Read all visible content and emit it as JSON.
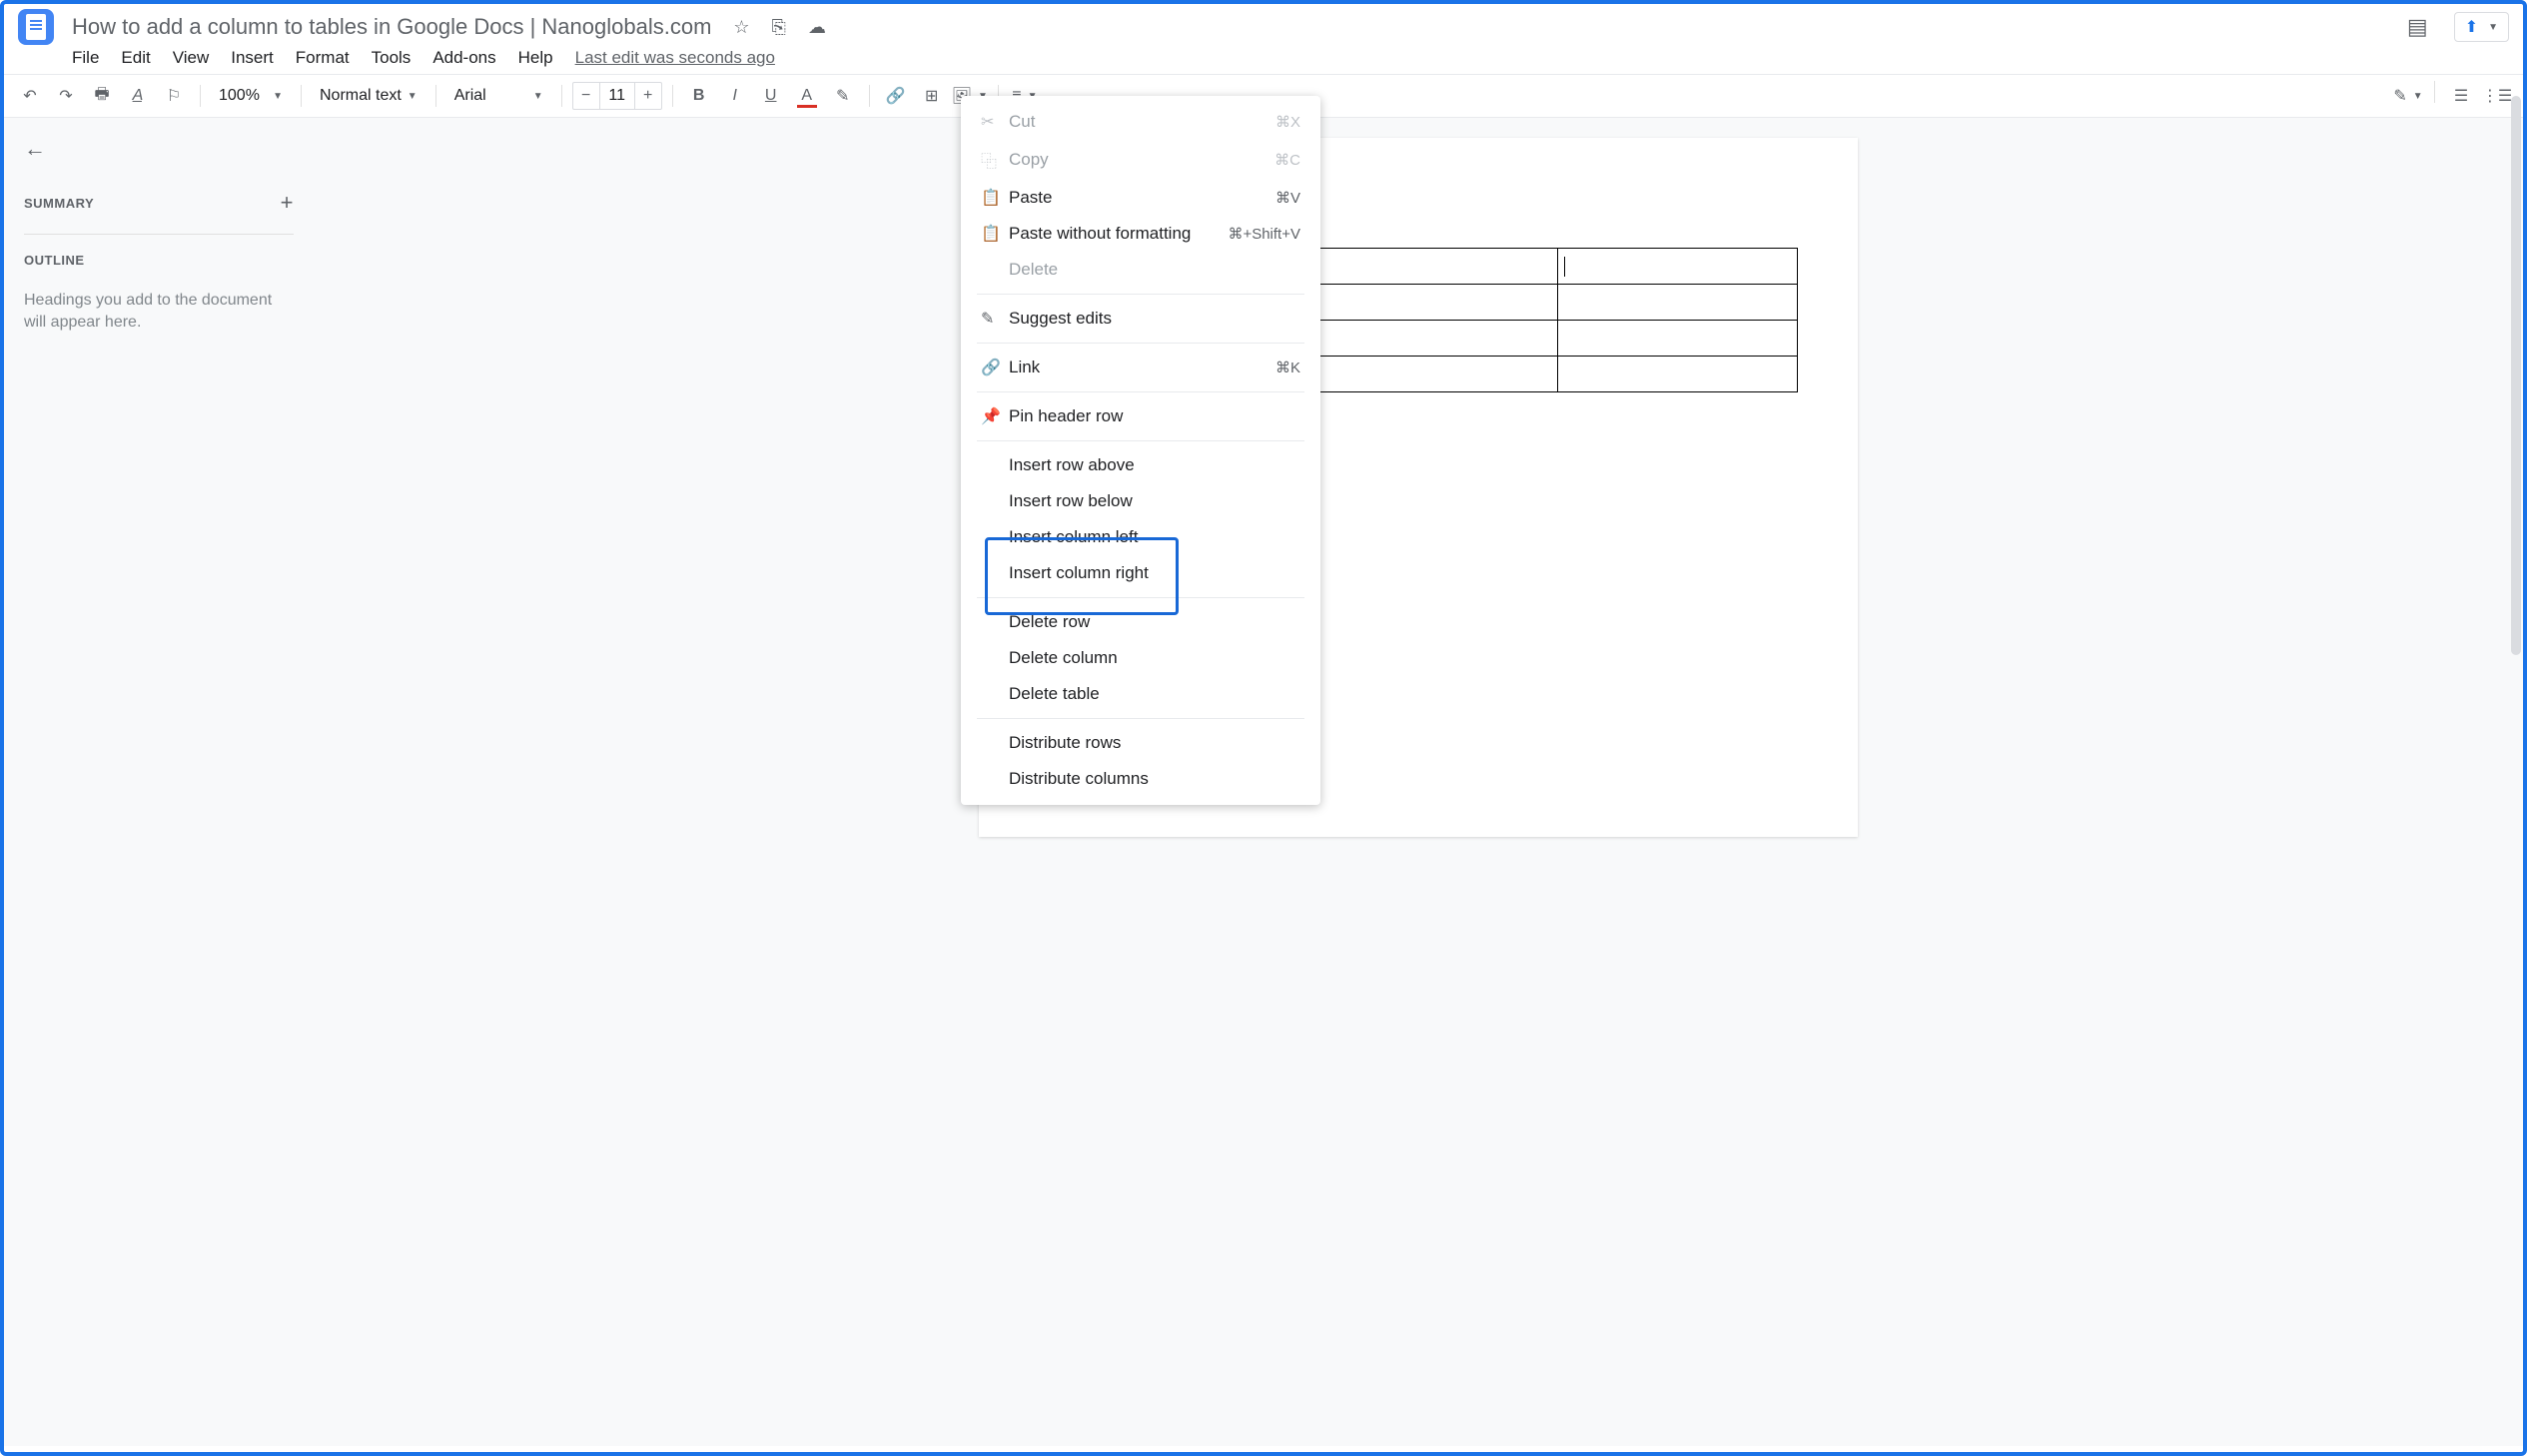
{
  "header": {
    "title": "How to add a column to tables in Google Docs | Nanoglobals.com",
    "last_edit": "Last edit was seconds ago"
  },
  "menus": {
    "file": "File",
    "edit": "Edit",
    "view": "View",
    "insert": "Insert",
    "format": "Format",
    "tools": "Tools",
    "addons": "Add-ons",
    "help": "Help"
  },
  "toolbar": {
    "zoom": "100%",
    "style": "Normal text",
    "font": "Arial",
    "font_size": "11"
  },
  "sidebar": {
    "summary": "SUMMARY",
    "outline": "OUTLINE",
    "outline_empty": "Headings you add to the document will appear here."
  },
  "context_menu": {
    "cut": {
      "label": "Cut",
      "shortcut": "⌘X"
    },
    "copy": {
      "label": "Copy",
      "shortcut": "⌘C"
    },
    "paste": {
      "label": "Paste",
      "shortcut": "⌘V"
    },
    "paste_no_format": {
      "label": "Paste without formatting",
      "shortcut": "⌘+Shift+V"
    },
    "delete": {
      "label": "Delete"
    },
    "suggest": {
      "label": "Suggest edits"
    },
    "link": {
      "label": "Link",
      "shortcut": "⌘K"
    },
    "pin_header": {
      "label": "Pin header row"
    },
    "insert_row_above": {
      "label": "Insert row above"
    },
    "insert_row_below": {
      "label": "Insert row below"
    },
    "insert_col_left": {
      "label": "Insert column left"
    },
    "insert_col_right": {
      "label": "Insert column right"
    },
    "delete_row": {
      "label": "Delete row"
    },
    "delete_column": {
      "label": "Delete column"
    },
    "delete_table": {
      "label": "Delete table"
    },
    "distribute_rows": {
      "label": "Distribute rows"
    },
    "distribute_columns": {
      "label": "Distribute columns"
    }
  }
}
